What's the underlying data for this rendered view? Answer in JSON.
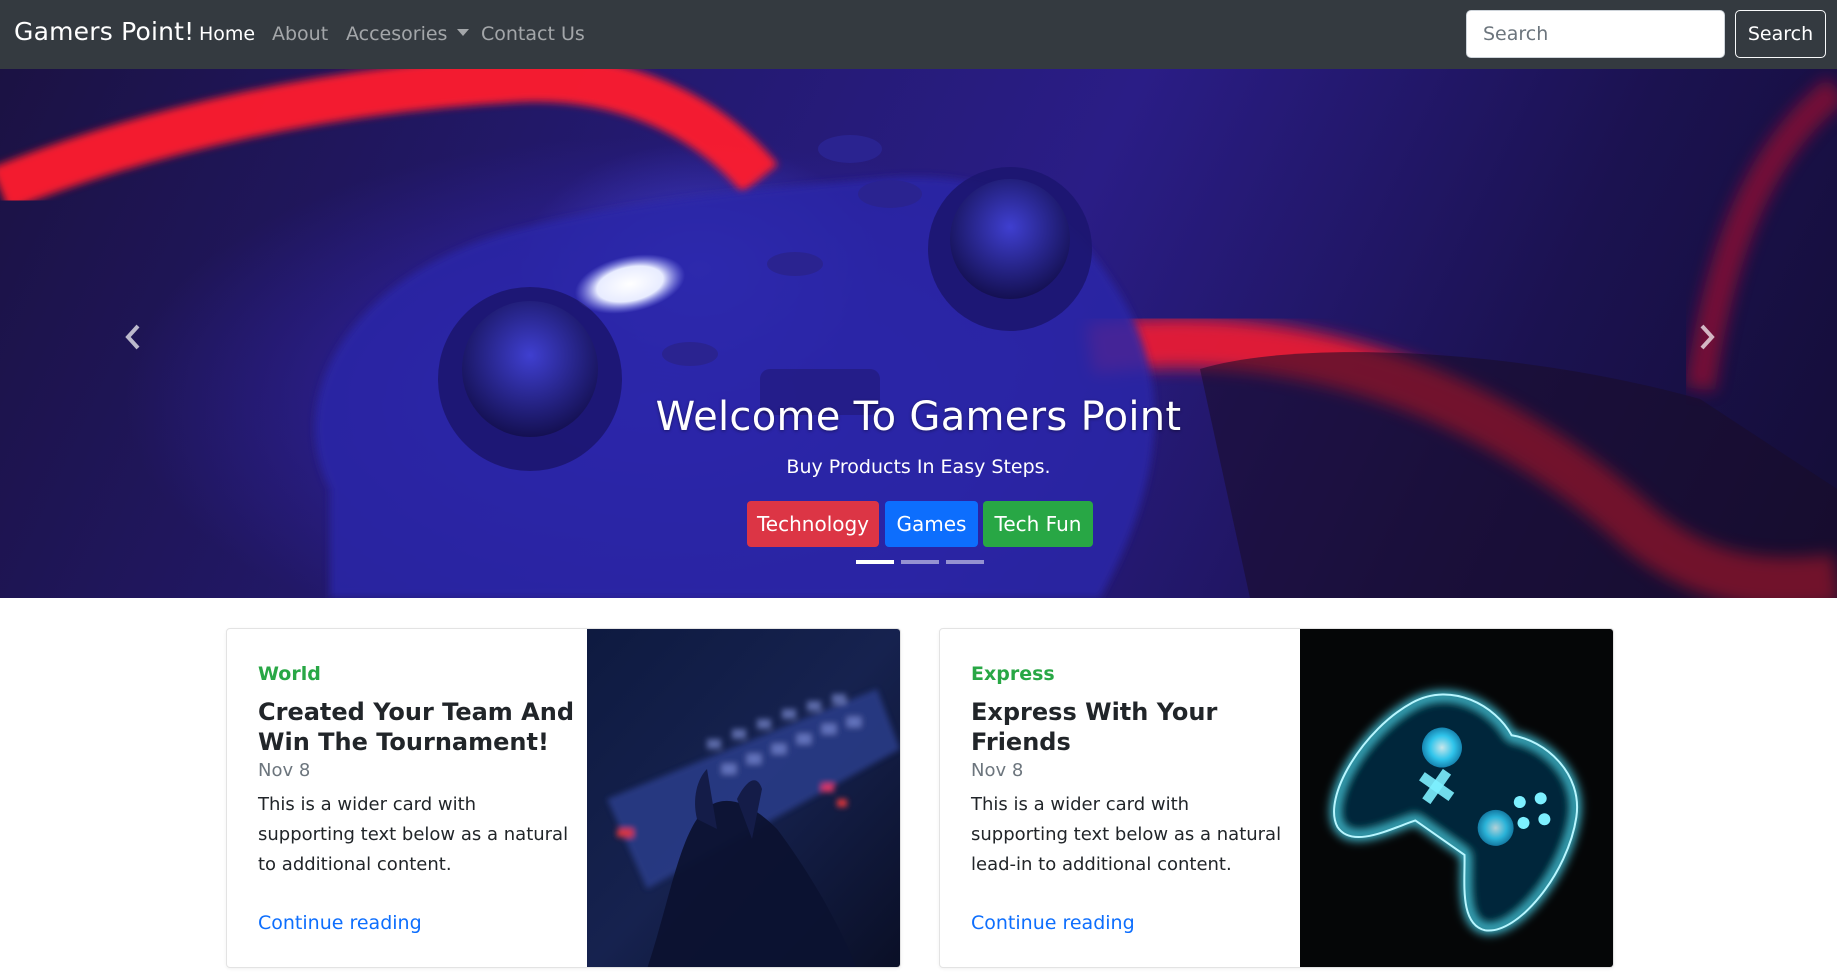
{
  "navbar": {
    "brand": "Gamers Point!",
    "links": [
      {
        "label": "Home",
        "active": true
      },
      {
        "label": "About",
        "active": false
      },
      {
        "label": "Accesories",
        "active": false,
        "dropdown": true
      },
      {
        "label": "Contact Us",
        "active": false
      }
    ],
    "search_placeholder": "Search",
    "search_button": "Search"
  },
  "hero": {
    "title": "Welcome To Gamers Point",
    "subtitle": "Buy Products In Easy Steps.",
    "buttons": [
      {
        "label": "Technology",
        "color": "#dc3545"
      },
      {
        "label": "Games",
        "color": "#0d6efd"
      },
      {
        "label": "Tech Fun",
        "color": "#28a745"
      }
    ],
    "indicators": [
      true,
      false,
      false
    ],
    "prev_icon": "chevron-left-icon",
    "next_icon": "chevron-right-icon"
  },
  "cards": [
    {
      "category": "World",
      "title": "Created Your Team And Win The Tournament!",
      "date": "Nov 8",
      "text": "This is a wider card with supporting text below as a natural to additional content.",
      "link": "Continue reading",
      "image": "keyboard-photo"
    },
    {
      "category": "Express",
      "title": "Express With Your Friends",
      "date": "Nov 8",
      "text": "This is a wider card with supporting text below as a natural lead-in to additional content.",
      "link": "Continue reading",
      "image": "glowing-controller-photo"
    }
  ]
}
